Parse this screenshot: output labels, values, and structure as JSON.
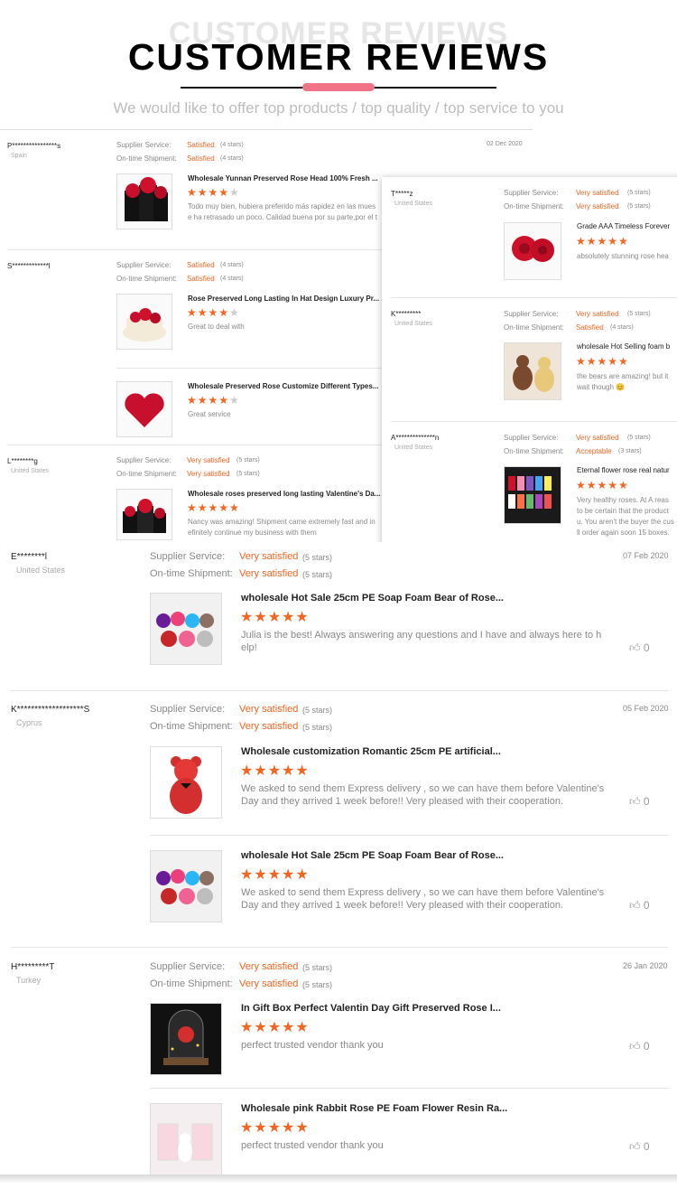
{
  "header": {
    "ghost": "CUSTOMER REVIEWS",
    "title": "CUSTOMER REVIEWS",
    "subtitle": "We would like to offer top products / top quality / top service to you"
  },
  "labels": {
    "supplier": "Supplier Service:",
    "shipment": "On-time Shipment:"
  },
  "left_panel": [
    {
      "name": "P****************s",
      "country": "Spain",
      "date": "02 Dec 2020",
      "supplier": "Satisfied",
      "supplier_stars": "(4 stars)",
      "shipment": "Satisfied",
      "shipment_stars": "(4 stars)",
      "items": [
        {
          "title": "Wholesale Yunnan Preserved Rose Head 100% Fresh ...",
          "rating": 4,
          "text": "Todo muy bien, hubiera preferido más rapidez en las mues",
          "text2": "e ha retrasado un poco. Calidad buena por su parte,por el t"
        }
      ]
    },
    {
      "name": "S*************l",
      "country": "",
      "date": "",
      "supplier": "Satisfied",
      "supplier_stars": "(4 stars)",
      "shipment": "Satisfied",
      "shipment_stars": "(4 stars)",
      "items": [
        {
          "title": "Rose Preserved Long Lasting In Hat Design Luxury Pr...",
          "rating": 4,
          "text": "Great to deal with",
          "text2": ""
        },
        {
          "title": "Wholesale Preserved Rose Customize Different Types...",
          "rating": 4,
          "text": "Great service",
          "text2": ""
        }
      ]
    },
    {
      "name": "L********g",
      "country": "United States",
      "date": "",
      "supplier": "Very satisfied",
      "supplier_stars": "(5 stars)",
      "shipment": "Very satisfied",
      "shipment_stars": "(5 stars)",
      "items": [
        {
          "title": "Wholesale roses preserved long lasting Valentine's Da...",
          "rating": 5,
          "text": "Nancy was amazing! Shipment came extremely fast and in",
          "text2": "efinitely continue my business with them"
        }
      ]
    }
  ],
  "right_panel": [
    {
      "name": "T*****z",
      "country": "United States",
      "supplier": "Very satisfied",
      "supplier_stars": "(5 stars)",
      "shipment": "Very satisfied",
      "shipment_stars": "(5 stars)",
      "items": [
        {
          "title": "Grade AAA Timeless Forever",
          "rating": 5,
          "text": "absolutely stunning rose hea",
          "text2": ""
        }
      ]
    },
    {
      "name": "K*********",
      "country": "United States",
      "supplier": "Very satisfied",
      "supplier_stars": "(5 stars)",
      "shipment": "Satisfied",
      "shipment_stars": "(4 stars)",
      "items": [
        {
          "title": "wholesale Hot Selling foam b",
          "rating": 5,
          "text": "the bears are amazing! but it",
          "text2": "wait though 😊"
        }
      ]
    },
    {
      "name": "A**************n",
      "country": "United States",
      "supplier": "Very satisfied",
      "supplier_stars": "(5 stars)",
      "shipment": "Acceptable",
      "shipment_stars": "(3 stars)",
      "items": [
        {
          "title": "Eternal flower rose real natur",
          "rating": 5,
          "text": "Very healthy roses. At A reas",
          "text2": "to be certain that the product",
          "text3": "u. You aren't the buyer the cus",
          "text4": "ll order again soon 15 boxes."
        }
      ]
    }
  ],
  "main": [
    {
      "name": "E********l",
      "country": "United States",
      "date": "07 Feb 2020",
      "supplier": "Very satisfied",
      "supplier_stars": "(5 stars)",
      "shipment": "Very satisfied",
      "shipment_stars": "(5 stars)",
      "items": [
        {
          "title": "wholesale Hot Sale 25cm PE Soap Foam Bear of Rose...",
          "rating": 5,
          "text": "Julia is the best! Always answering any questions and I have and always here to h",
          "text2": "elp!",
          "likes": "0"
        }
      ]
    },
    {
      "name": "K*******************S",
      "country": "Cyprus",
      "date": "05 Feb 2020",
      "supplier": "Very satisfied",
      "supplier_stars": "(5 stars)",
      "shipment": "Very satisfied",
      "shipment_stars": "(5 stars)",
      "items": [
        {
          "title": "Wholesale customization Romantic 25cm PE artificial...",
          "rating": 5,
          "text": "We asked to send them Express delivery , so we can have them before Valentine's",
          "text2": "Day and they arrived 1 week before!! Very pleased with their cooperation.",
          "likes": "0"
        },
        {
          "title": "wholesale Hot Sale 25cm PE Soap Foam Bear of Rose...",
          "rating": 5,
          "text": "We asked to send them Express delivery , so we can have them before Valentine's",
          "text2": "Day and they arrived 1 week before!! Very pleased with their cooperation.",
          "likes": "0"
        }
      ]
    },
    {
      "name": "H*********T",
      "country": "Turkey",
      "date": "26 Jan 2020",
      "supplier": "Very satisfied",
      "supplier_stars": "(5 stars)",
      "shipment": "Very satisfied",
      "shipment_stars": "(5 stars)",
      "items": [
        {
          "title": "In Gift Box Perfect Valentin Day Gift Preserved Rose I...",
          "rating": 5,
          "text": "perfect trusted vendor thank you",
          "text2": "",
          "likes": "0"
        },
        {
          "title": "Wholesale pink Rabbit Rose PE Foam Flower Resin Ra...",
          "rating": 5,
          "text": "perfect trusted vendor thank you",
          "text2": "",
          "likes": "0"
        }
      ]
    }
  ],
  "colors": {
    "accent": "#f26522",
    "pill": "#f07388"
  }
}
